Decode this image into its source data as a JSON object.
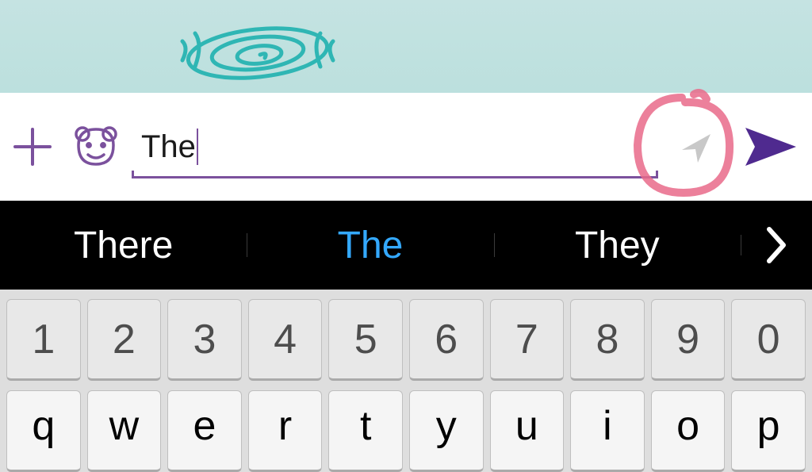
{
  "colors": {
    "accent_purple": "#7b519d",
    "send_purple": "#4f2a8f",
    "suggestion_active": "#34a9ff",
    "location_grey": "#bdbdbd",
    "annotation_pink": "#e96b8a"
  },
  "input": {
    "value": "The"
  },
  "suggestions": {
    "items": [
      "There",
      "The",
      "They"
    ],
    "active_index": 1,
    "more_label": "›"
  },
  "keyboard": {
    "row1": [
      "1",
      "2",
      "3",
      "4",
      "5",
      "6",
      "7",
      "8",
      "9",
      "0"
    ],
    "row2": [
      "q",
      "w",
      "e",
      "r",
      "t",
      "y",
      "u",
      "i",
      "o",
      "p"
    ]
  },
  "icons": {
    "plus": "plus",
    "sticker": "bear-face",
    "location": "location-arrow",
    "send": "paper-plane"
  }
}
